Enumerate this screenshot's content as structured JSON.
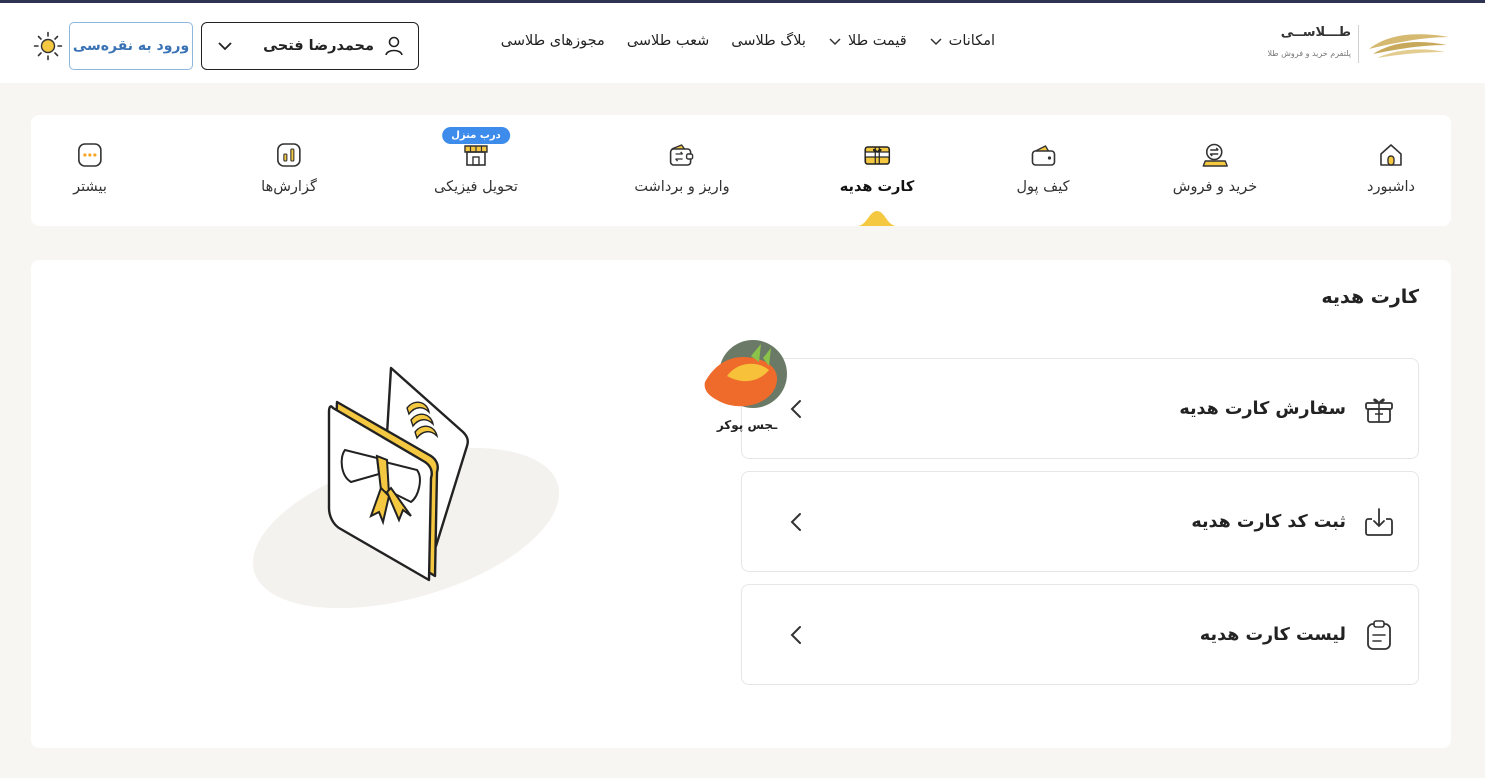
{
  "brand": {
    "name": "طـــلاســی",
    "tagline": "پلتفرم خرید و فروش طلا"
  },
  "topnav": [
    {
      "label": "امکانات",
      "has_dropdown": true
    },
    {
      "label": "قیمت طلا",
      "has_dropdown": true
    },
    {
      "label": "بلاگ طلاسی",
      "has_dropdown": false
    },
    {
      "label": "شعب طلاسی",
      "has_dropdown": false
    },
    {
      "label": "مجوزهای طلاسی",
      "has_dropdown": false
    }
  ],
  "user": {
    "name": "محمدرضا فتحی"
  },
  "silver_login": "ورود به نقره‌سی",
  "tabs": [
    {
      "label": "داشبورد",
      "icon": "home-icon"
    },
    {
      "label": "خرید و فروش",
      "icon": "exchange-icon"
    },
    {
      "label": "کیف پول",
      "icon": "wallet-icon"
    },
    {
      "label": "کارت هدیه",
      "icon": "gift-card-icon",
      "active": true
    },
    {
      "label": "واریز و برداشت",
      "icon": "deposit-withdraw-icon"
    },
    {
      "label": "تحویل فیزیکی",
      "icon": "shop-icon",
      "badge": "درب منزل"
    },
    {
      "label": "گزارش‌ها",
      "icon": "report-icon"
    },
    {
      "label": "بیشتر",
      "icon": "more-icon"
    }
  ],
  "page": {
    "title": "کارت هدیه",
    "cards": [
      {
        "label": "سفارش کارت هدیه",
        "icon": "gift-box-icon"
      },
      {
        "label": "ثبت کد کارت هدیه",
        "icon": "download-icon"
      },
      {
        "label": "لیست کارت هدیه",
        "icon": "clipboard-icon"
      }
    ]
  },
  "watermark": {
    "text": "ـجس پوکر"
  },
  "colors": {
    "accent": "#f5c842",
    "badge": "#3d8bea",
    "silver": "#3a73b5",
    "topline": "#2d3350"
  }
}
